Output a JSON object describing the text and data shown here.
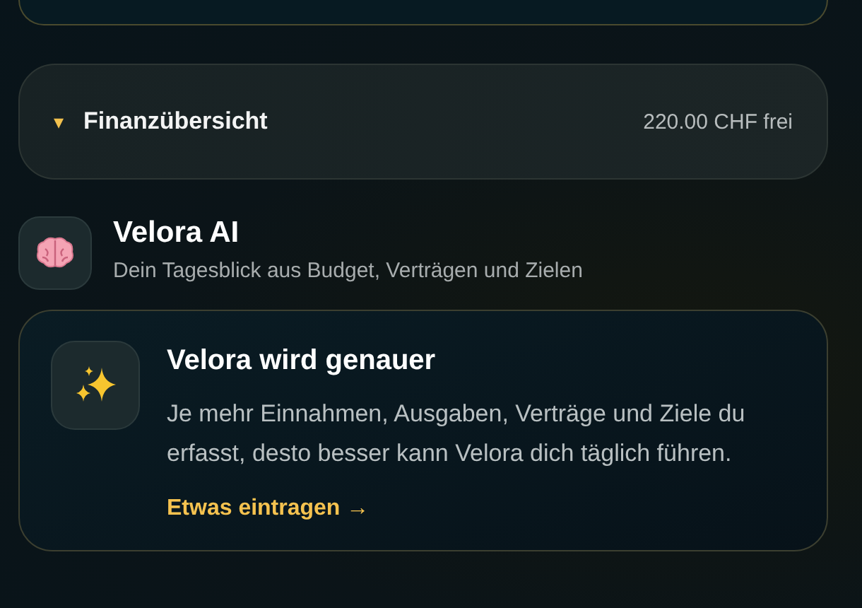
{
  "finance_summary": {
    "toggle": "▾",
    "title": "Finanzübersicht",
    "amount": "220.00 CHF frei"
  },
  "assistant": {
    "title": "Velora AI",
    "subtitle": "Dein Tagesblick aus Budget, Verträgen und Zielen"
  },
  "tip_card": {
    "title": "Velora wird genauer",
    "body": "Je mehr Einnahmen, Ausgaben, Verträge und Ziele du erfasst, desto besser kann Velora dich täglich führen.",
    "link": "Etwas eintragen →"
  }
}
